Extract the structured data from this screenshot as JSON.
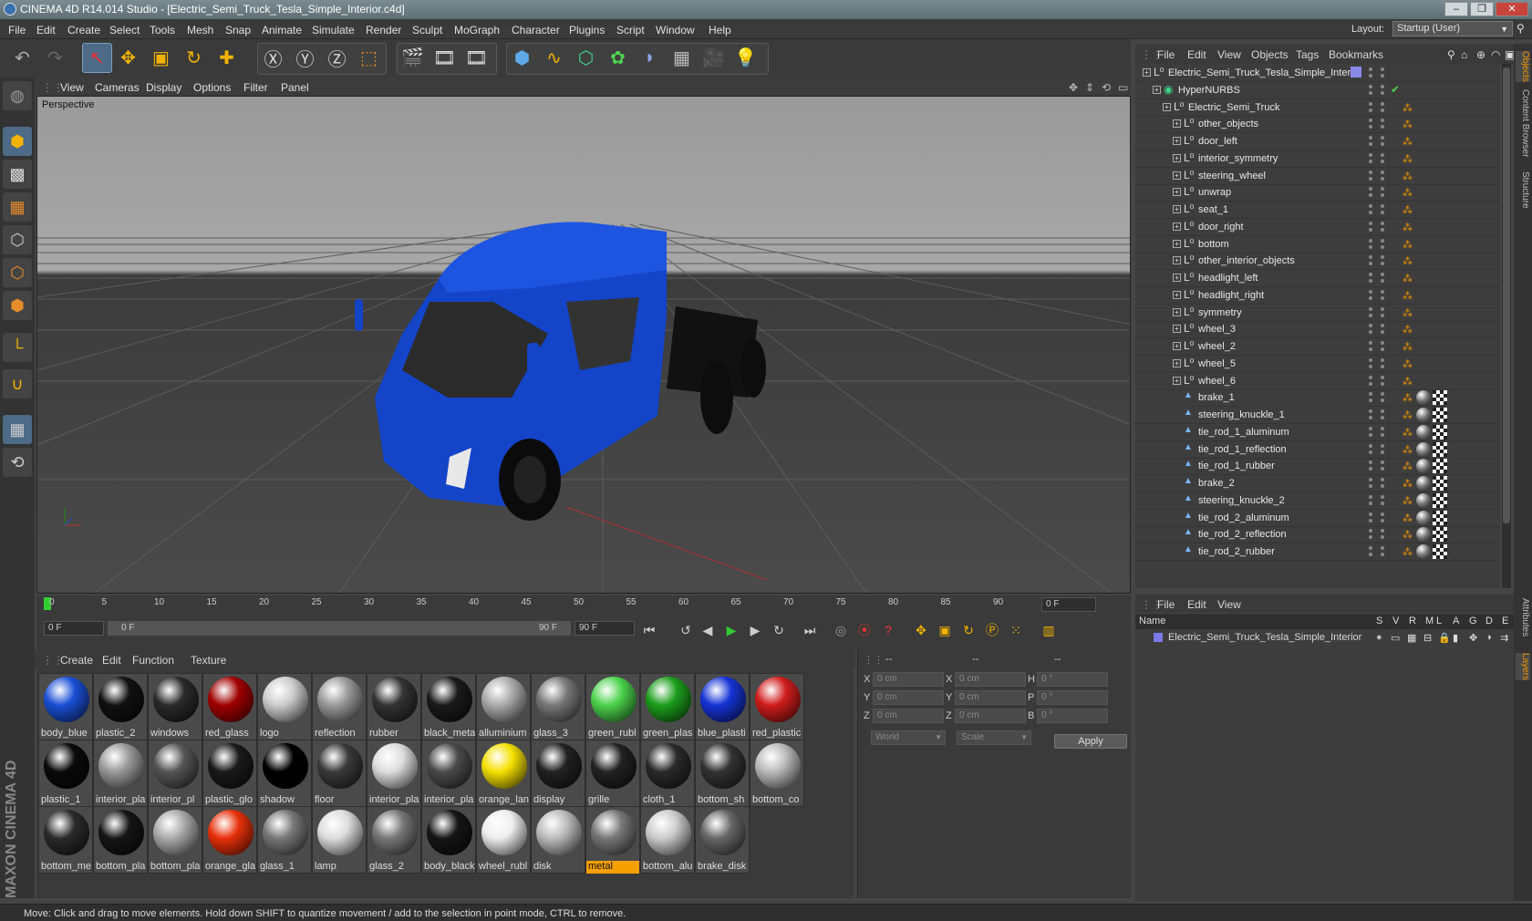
{
  "window": {
    "title": "CINEMA 4D R14.014 Studio - [Electric_Semi_Truck_Tesla_Simple_Interior.c4d]"
  },
  "menu": [
    "File",
    "Edit",
    "Create",
    "Select",
    "Tools",
    "Mesh",
    "Snap",
    "Animate",
    "Simulate",
    "Render",
    "Sculpt",
    "MoGraph",
    "Character",
    "Plugins",
    "Script",
    "Window",
    "Help"
  ],
  "layout": {
    "label": "Layout:",
    "value": "Startup (User)"
  },
  "viewport": {
    "menu": [
      "View",
      "Cameras",
      "Display",
      "Options",
      "Filter",
      "Panel"
    ],
    "label": "Perspective"
  },
  "timeline": {
    "ticks": [
      "0",
      "5",
      "10",
      "15",
      "20",
      "25",
      "30",
      "35",
      "40",
      "45",
      "50",
      "55",
      "60",
      "65",
      "70",
      "75",
      "80",
      "85",
      "90"
    ],
    "frame_field": "0 F"
  },
  "transport": {
    "start": "0 F",
    "slider_left": "0 F",
    "slider_right": "90 F",
    "end": "90 F"
  },
  "materials": {
    "menu": [
      "Create",
      "Edit",
      "Function",
      "Texture"
    ],
    "items": [
      {
        "name": "body_blue",
        "color": "#1a4fd6"
      },
      {
        "name": "plastic_2",
        "color": "#111"
      },
      {
        "name": "windows",
        "color": "#2a2a2a"
      },
      {
        "name": "red_glass",
        "color": "#a00000"
      },
      {
        "name": "logo",
        "color": "#ccc"
      },
      {
        "name": "reflection",
        "color": "#999"
      },
      {
        "name": "rubber",
        "color": "#333"
      },
      {
        "name": "black_meta",
        "color": "#1a1a1a"
      },
      {
        "name": "alluminium",
        "color": "#aaa"
      },
      {
        "name": "glass_3",
        "color": "#777"
      },
      {
        "name": "green_rubl",
        "color": "#4cd34c"
      },
      {
        "name": "green_plas",
        "color": "#1c9e1c"
      },
      {
        "name": "blue_plasti",
        "color": "#1533d6"
      },
      {
        "name": "red_plastic",
        "color": "#d01c1c"
      },
      {
        "name": "plastic_1",
        "color": "#0a0a0a"
      },
      {
        "name": "interior_pla",
        "color": "#999"
      },
      {
        "name": "interior_pl",
        "color": "#555"
      },
      {
        "name": "plastic_glo",
        "color": "#1a1a1a"
      },
      {
        "name": "shadow",
        "color": "#000"
      },
      {
        "name": "floor",
        "color": "#3a3a3a"
      },
      {
        "name": "interior_pla",
        "color": "#ddd"
      },
      {
        "name": "interior_pla",
        "color": "#4a4a4a"
      },
      {
        "name": "orange_lan",
        "color": "#f5e000"
      },
      {
        "name": "display",
        "color": "#222"
      },
      {
        "name": "grille",
        "color": "#222"
      },
      {
        "name": "cloth_1",
        "color": "#2a2a2a"
      },
      {
        "name": "bottom_sh",
        "color": "#333"
      },
      {
        "name": "bottom_co",
        "color": "#bbb"
      },
      {
        "name": "bottom_me",
        "color": "#2a2a2a"
      },
      {
        "name": "bottom_pla",
        "color": "#151515"
      },
      {
        "name": "bottom_pla",
        "color": "#aaa"
      },
      {
        "name": "orange_gla",
        "color": "#e8300a"
      },
      {
        "name": "glass_1",
        "color": "#777"
      },
      {
        "name": "lamp",
        "color": "#ddd"
      },
      {
        "name": "glass_2",
        "color": "#777"
      },
      {
        "name": "body_black",
        "color": "#151515"
      },
      {
        "name": "wheel_rubl",
        "color": "#eee"
      },
      {
        "name": "disk",
        "color": "#bbb"
      },
      {
        "name": "metal",
        "color": "#777",
        "selected": true
      },
      {
        "name": "bottom_alu",
        "color": "#ccc"
      },
      {
        "name": "brake_disk",
        "color": "#666"
      }
    ]
  },
  "coords": {
    "header": [
      "--",
      "--",
      "--"
    ],
    "rows": [
      {
        "a": "X",
        "av": "0 cm",
        "b": "X",
        "bv": "0 cm",
        "c": "H",
        "cv": "0 °"
      },
      {
        "a": "Y",
        "av": "0 cm",
        "b": "Y",
        "bv": "0 cm",
        "c": "P",
        "cv": "0 °"
      },
      {
        "a": "Z",
        "av": "0 cm",
        "b": "Z",
        "bv": "0 cm",
        "c": "B",
        "cv": "0 °"
      }
    ],
    "mode1": "World",
    "mode2": "Scale",
    "apply": "Apply"
  },
  "objects": {
    "menu": [
      "File",
      "Edit",
      "View",
      "Objects",
      "Tags",
      "Bookmarks"
    ],
    "tree": [
      {
        "name": "Electric_Semi_Truck_Tesla_Simple_Interior",
        "depth": 0,
        "type": "null"
      },
      {
        "name": "HyperNURBS",
        "depth": 1,
        "type": "nurbs"
      },
      {
        "name": "Electric_Semi_Truck",
        "depth": 2,
        "type": "null"
      },
      {
        "name": "other_objects",
        "depth": 3,
        "type": "null"
      },
      {
        "name": "door_left",
        "depth": 3,
        "type": "null"
      },
      {
        "name": "interior_symmetry",
        "depth": 3,
        "type": "null"
      },
      {
        "name": "steering_wheel",
        "depth": 3,
        "type": "null"
      },
      {
        "name": "unwrap",
        "depth": 3,
        "type": "null"
      },
      {
        "name": "seat_1",
        "depth": 3,
        "type": "null"
      },
      {
        "name": "door_right",
        "depth": 3,
        "type": "null"
      },
      {
        "name": "bottom",
        "depth": 3,
        "type": "null"
      },
      {
        "name": "other_interior_objects",
        "depth": 3,
        "type": "null"
      },
      {
        "name": "headlight_left",
        "depth": 3,
        "type": "null"
      },
      {
        "name": "headlight_right",
        "depth": 3,
        "type": "null"
      },
      {
        "name": "symmetry",
        "depth": 3,
        "type": "null"
      },
      {
        "name": "wheel_3",
        "depth": 3,
        "type": "null"
      },
      {
        "name": "wheel_2",
        "depth": 3,
        "type": "null"
      },
      {
        "name": "wheel_5",
        "depth": 3,
        "type": "null"
      },
      {
        "name": "wheel_6",
        "depth": 3,
        "type": "null"
      },
      {
        "name": "brake_1",
        "depth": 3,
        "type": "poly"
      },
      {
        "name": "steering_knuckle_1",
        "depth": 3,
        "type": "poly"
      },
      {
        "name": "tie_rod_1_aluminum",
        "depth": 3,
        "type": "poly"
      },
      {
        "name": "tie_rod_1_reflection",
        "depth": 3,
        "type": "poly"
      },
      {
        "name": "tie_rod_1_rubber",
        "depth": 3,
        "type": "poly"
      },
      {
        "name": "brake_2",
        "depth": 3,
        "type": "poly"
      },
      {
        "name": "steering_knuckle_2",
        "depth": 3,
        "type": "poly"
      },
      {
        "name": "tie_rod_2_aluminum",
        "depth": 3,
        "type": "poly"
      },
      {
        "name": "tie_rod_2_reflection",
        "depth": 3,
        "type": "poly"
      },
      {
        "name": "tie_rod_2_rubber",
        "depth": 3,
        "type": "poly"
      }
    ]
  },
  "layers": {
    "menu": [
      "File",
      "Edit",
      "View"
    ],
    "header": {
      "name": "Name",
      "cols": [
        "S",
        "V",
        "R",
        "M",
        "L",
        "A",
        "G",
        "D",
        "E"
      ]
    },
    "row": "Electric_Semi_Truck_Tesla_Simple_Interior"
  },
  "side_tabs": [
    "Objects",
    "Content Browser",
    "Structure",
    "Attributes",
    "Layers"
  ],
  "status": "Move: Click and drag to move elements. Hold down SHIFT to quantize movement / add to the selection in point mode, CTRL to remove.",
  "brand": "MAXON CINEMA 4D"
}
